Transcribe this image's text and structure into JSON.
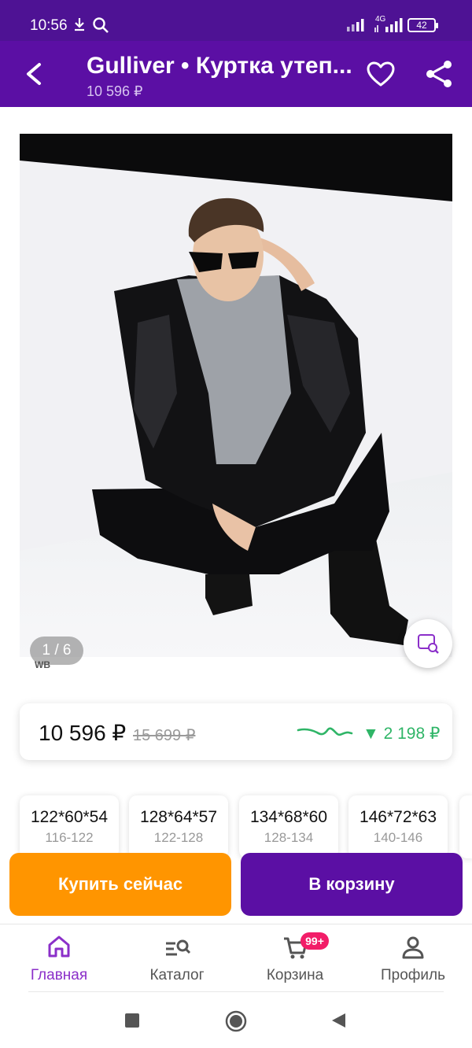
{
  "status_bar": {
    "time": "10:56",
    "battery": "42",
    "network": "4G"
  },
  "app_bar": {
    "title": "Gulliver • Куртка утеп...",
    "price": "10 596 ₽"
  },
  "gallery": {
    "counter": "1 / 6",
    "watermark": "WB"
  },
  "price_card": {
    "current": "10 596 ₽",
    "old": "15 699 ₽",
    "drop": "▼ 2 198 ₽"
  },
  "sizes": [
    {
      "main": "122*60*54",
      "sub": "116-122"
    },
    {
      "main": "128*64*57",
      "sub": "122-128"
    },
    {
      "main": "134*68*60",
      "sub": "128-134"
    },
    {
      "main": "146*72*63",
      "sub": "140-146"
    }
  ],
  "actions": {
    "buy_now": "Купить сейчас",
    "add_to_cart": "В корзину"
  },
  "bottom_nav": {
    "items": [
      {
        "label": "Главная",
        "icon": "home-icon",
        "active": true
      },
      {
        "label": "Каталог",
        "icon": "catalog-search-icon"
      },
      {
        "label": "Корзина",
        "icon": "cart-icon",
        "badge": "99+"
      },
      {
        "label": "Профиль",
        "icon": "profile-icon"
      }
    ]
  },
  "colors": {
    "brand": "#5b0fa4",
    "buy": "#ff9500",
    "accent_active": "#8b2fc9",
    "price_drop": "#2fb567",
    "badge": "#f21d68"
  }
}
